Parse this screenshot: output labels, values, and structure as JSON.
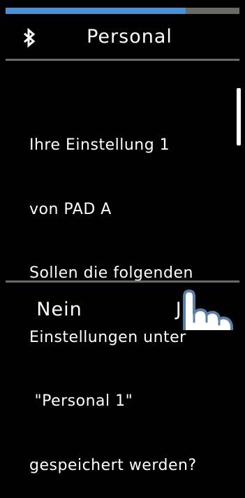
{
  "progress": {
    "fraction": 0.77,
    "fill_color": "#4a90d9",
    "track_color": "#6b6b63"
  },
  "header": {
    "icon": "bluetooth-icon",
    "title": "Personal"
  },
  "message": {
    "lines": [
      "Ihre Einstellung 1",
      "von PAD A",
      "Sollen die folgenden",
      "Einstellungen unter",
      " \"Personal 1\"",
      "gespeichert werden?"
    ]
  },
  "buttons": {
    "no_label": "Nein",
    "yes_label": "Ja"
  },
  "overlay": {
    "icon": "tap-hand-icon"
  }
}
